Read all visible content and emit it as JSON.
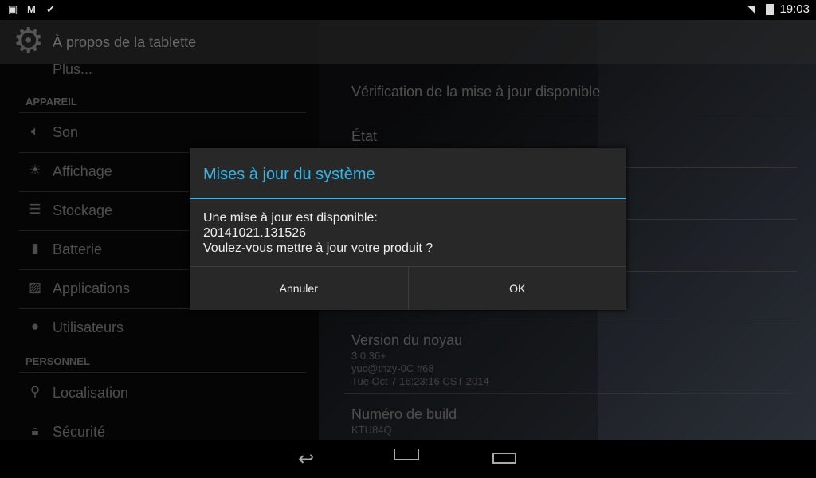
{
  "status_bar": {
    "time": "19:03",
    "icons": [
      "image-icon",
      "gmail-icon",
      "briefcase-check-icon",
      "wifi-icon",
      "battery-icon"
    ]
  },
  "action_bar": {
    "title": "À propos de la tablette",
    "icon": "settings-gear-icon"
  },
  "sidebar": {
    "partial_item": "Plus...",
    "sections": [
      {
        "header": "APPAREIL",
        "items": [
          {
            "label": "Son",
            "icon": "volume-icon"
          },
          {
            "label": "Affichage",
            "icon": "brightness-icon"
          },
          {
            "label": "Stockage",
            "icon": "storage-icon"
          },
          {
            "label": "Batterie",
            "icon": "battery-icon"
          },
          {
            "label": "Applications",
            "icon": "apps-icon"
          },
          {
            "label": "Utilisateurs",
            "icon": "user-icon"
          }
        ]
      },
      {
        "header": "PERSONNEL",
        "items": [
          {
            "label": "Localisation",
            "icon": "location-icon"
          },
          {
            "label": "Sécurité",
            "icon": "lock-icon"
          }
        ]
      }
    ]
  },
  "main": {
    "update_check": "Vérification de la mise à jour disponible",
    "state": "État",
    "kernel": {
      "title": "Version du noyau",
      "lines": [
        "3.0.36+",
        "yuc@thzy-0C #68",
        "Tue Oct 7 16:23:16 CST 2014"
      ]
    },
    "build": {
      "title": "Numéro de build",
      "value": "KTU84Q"
    }
  },
  "dialog": {
    "title": "Mises à jour du système",
    "lines": [
      "Une mise à jour est disponible:",
      "20141021.131526",
      "Voulez-vous mettre à jour votre produit ?"
    ],
    "cancel": "Annuler",
    "ok": "OK",
    "accent": "#33b5e5"
  },
  "nav": {
    "icons": [
      "back-icon",
      "home-icon",
      "recents-icon"
    ]
  }
}
